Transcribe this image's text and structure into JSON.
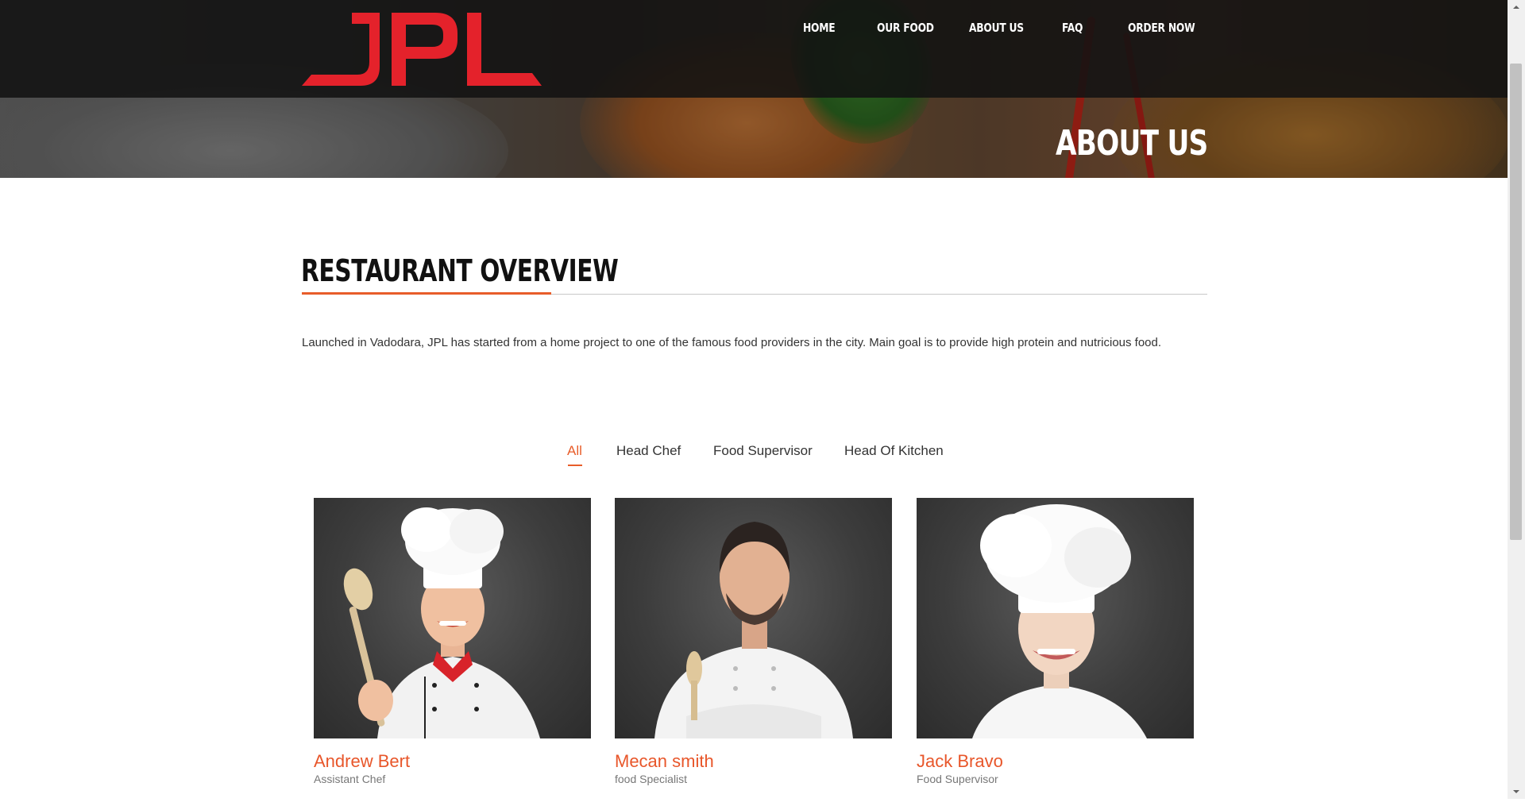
{
  "brand": {
    "logo_text": "JPL",
    "logo_color": "#e02020"
  },
  "nav": {
    "items": [
      {
        "label": "HOME"
      },
      {
        "label": "OUR FOOD"
      },
      {
        "label": "ABOUT US"
      },
      {
        "label": "FAQ"
      },
      {
        "label": "ORDER NOW"
      }
    ]
  },
  "hero": {
    "title": "ABOUT US"
  },
  "overview": {
    "title": "RESTAURANT OVERVIEW",
    "text": "Launched in Vadodara, JPL has started from a home project to one of the famous food providers in the city. Main goal is to provide high protein and nutricious food."
  },
  "filters": {
    "items": [
      {
        "label": "All",
        "active": true
      },
      {
        "label": "Head Chef"
      },
      {
        "label": "Food Supervisor"
      },
      {
        "label": "Head Of Kitchen"
      }
    ]
  },
  "team": [
    {
      "name": "Andrew Bert",
      "role": "Assistant Chef"
    },
    {
      "name": "Mecan smith",
      "role": "food Specialist"
    },
    {
      "name": "Jack Bravo",
      "role": "Food Supervisor"
    }
  ],
  "colors": {
    "accent": "#e85d2a",
    "header_bg": "#121212"
  }
}
